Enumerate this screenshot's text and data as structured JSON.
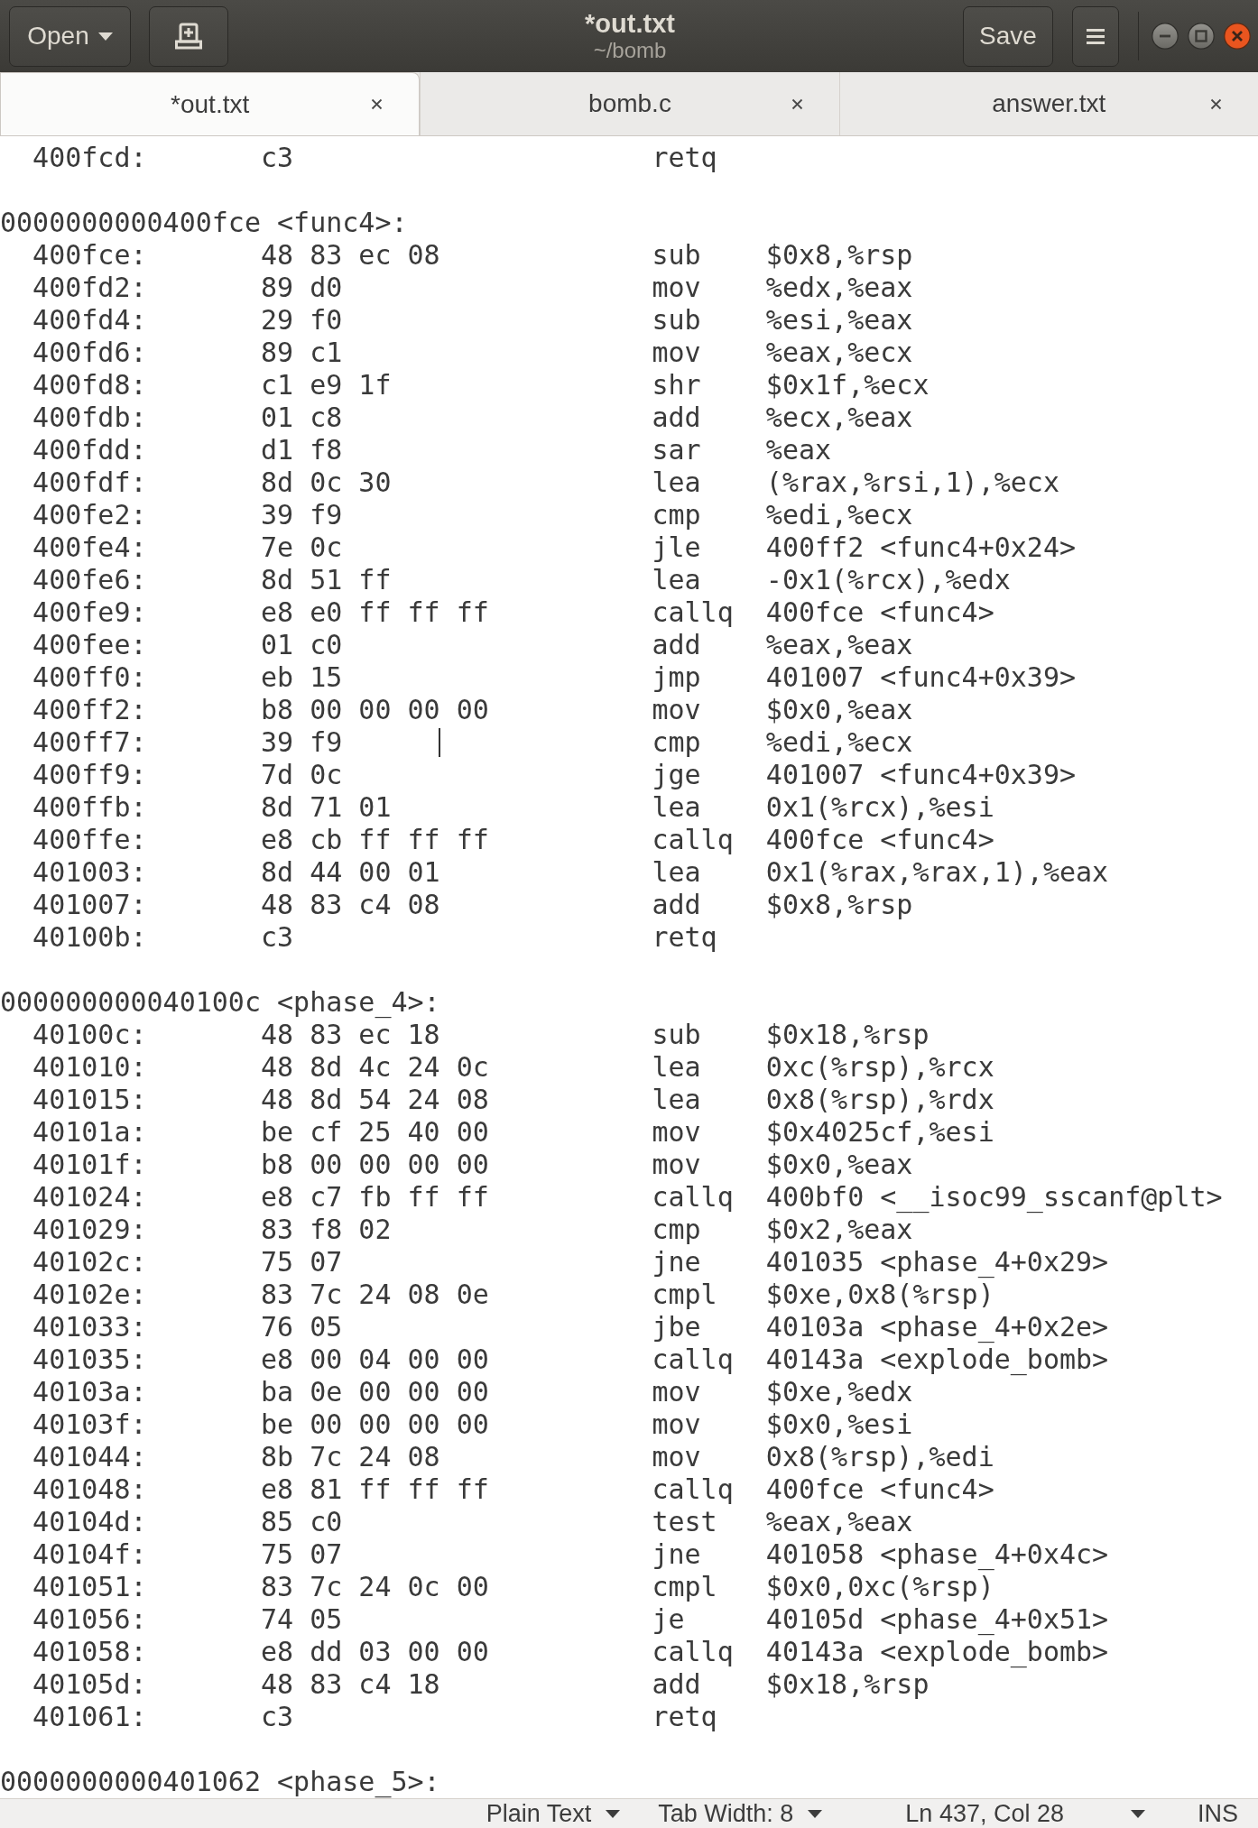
{
  "window": {
    "title": "*out.txt",
    "subtitle": "~/bomb"
  },
  "header": {
    "open_button": "Open",
    "save_button": "Save"
  },
  "tabs": [
    {
      "label": "*out.txt",
      "selected": true
    },
    {
      "label": "bomb.c",
      "selected": false
    },
    {
      "label": "answer.txt",
      "selected": false
    }
  ],
  "editor": {
    "lines": [
      {
        "kind": "instruction",
        "address": "400fcd:",
        "bytes": "c3",
        "mnemonic": "retq",
        "caret": false
      },
      {
        "kind": "blank",
        "caret": false
      },
      {
        "kind": "label",
        "text": "0000000000400fce <func4>:",
        "caret": false
      },
      {
        "kind": "instruction",
        "address": "400fce:",
        "bytes": "48 83 ec 08",
        "mnemonic": "sub",
        "operands": "$0x8,%rsp",
        "caret": false
      },
      {
        "kind": "instruction",
        "address": "400fd2:",
        "bytes": "89 d0",
        "mnemonic": "mov",
        "operands": "%edx,%eax",
        "caret": false
      },
      {
        "kind": "instruction",
        "address": "400fd4:",
        "bytes": "29 f0",
        "mnemonic": "sub",
        "operands": "%esi,%eax",
        "caret": false
      },
      {
        "kind": "instruction",
        "address": "400fd6:",
        "bytes": "89 c1",
        "mnemonic": "mov",
        "operands": "%eax,%ecx",
        "caret": false
      },
      {
        "kind": "instruction",
        "address": "400fd8:",
        "bytes": "c1 e9 1f",
        "mnemonic": "shr",
        "operands": "$0x1f,%ecx",
        "caret": false
      },
      {
        "kind": "instruction",
        "address": "400fdb:",
        "bytes": "01 c8",
        "mnemonic": "add",
        "operands": "%ecx,%eax",
        "caret": false
      },
      {
        "kind": "instruction",
        "address": "400fdd:",
        "bytes": "d1 f8",
        "mnemonic": "sar",
        "operands": "%eax",
        "caret": false
      },
      {
        "kind": "instruction",
        "address": "400fdf:",
        "bytes": "8d 0c 30",
        "mnemonic": "lea",
        "operands": "(%rax,%rsi,1),%ecx",
        "caret": false
      },
      {
        "kind": "instruction",
        "address": "400fe2:",
        "bytes": "39 f9",
        "mnemonic": "cmp",
        "operands": "%edi,%ecx",
        "caret": false
      },
      {
        "kind": "instruction",
        "address": "400fe4:",
        "bytes": "7e 0c",
        "mnemonic": "jle",
        "operands": "400ff2 <func4+0x24>",
        "caret": false
      },
      {
        "kind": "instruction",
        "address": "400fe6:",
        "bytes": "8d 51 ff",
        "mnemonic": "lea",
        "operands": "-0x1(%rcx),%edx",
        "caret": false
      },
      {
        "kind": "instruction",
        "address": "400fe9:",
        "bytes": "e8 e0 ff ff ff",
        "mnemonic": "callq",
        "operands": "400fce <func4>",
        "caret": false
      },
      {
        "kind": "instruction",
        "address": "400fee:",
        "bytes": "01 c0",
        "mnemonic": "add",
        "operands": "%eax,%eax",
        "caret": false
      },
      {
        "kind": "instruction",
        "address": "400ff0:",
        "bytes": "eb 15",
        "mnemonic": "jmp",
        "operands": "401007 <func4+0x39>",
        "caret": false
      },
      {
        "kind": "instruction",
        "address": "400ff2:",
        "bytes": "b8 00 00 00 00",
        "mnemonic": "mov",
        "operands": "$0x0,%eax",
        "caret": false
      },
      {
        "kind": "instruction",
        "address": "400ff7:",
        "bytes": "39 f9",
        "mnemonic": "cmp",
        "operands": "%edi,%ecx",
        "caret": true
      },
      {
        "kind": "instruction",
        "address": "400ff9:",
        "bytes": "7d 0c",
        "mnemonic": "jge",
        "operands": "401007 <func4+0x39>",
        "caret": false
      },
      {
        "kind": "instruction",
        "address": "400ffb:",
        "bytes": "8d 71 01",
        "mnemonic": "lea",
        "operands": "0x1(%rcx),%esi",
        "caret": false
      },
      {
        "kind": "instruction",
        "address": "400ffe:",
        "bytes": "e8 cb ff ff ff",
        "mnemonic": "callq",
        "operands": "400fce <func4>",
        "caret": false
      },
      {
        "kind": "instruction",
        "address": "401003:",
        "bytes": "8d 44 00 01",
        "mnemonic": "lea",
        "operands": "0x1(%rax,%rax,1),%eax",
        "caret": false
      },
      {
        "kind": "instruction",
        "address": "401007:",
        "bytes": "48 83 c4 08",
        "mnemonic": "add",
        "operands": "$0x8,%rsp",
        "caret": false
      },
      {
        "kind": "instruction",
        "address": "40100b:",
        "bytes": "c3",
        "mnemonic": "retq",
        "caret": false
      },
      {
        "kind": "blank",
        "caret": false
      },
      {
        "kind": "label",
        "text": "000000000040100c <phase_4>:",
        "caret": false
      },
      {
        "kind": "instruction",
        "address": "40100c:",
        "bytes": "48 83 ec 18",
        "mnemonic": "sub",
        "operands": "$0x18,%rsp",
        "caret": false
      },
      {
        "kind": "instruction",
        "address": "401010:",
        "bytes": "48 8d 4c 24 0c",
        "mnemonic": "lea",
        "operands": "0xc(%rsp),%rcx",
        "caret": false
      },
      {
        "kind": "instruction",
        "address": "401015:",
        "bytes": "48 8d 54 24 08",
        "mnemonic": "lea",
        "operands": "0x8(%rsp),%rdx",
        "caret": false
      },
      {
        "kind": "instruction",
        "address": "40101a:",
        "bytes": "be cf 25 40 00",
        "mnemonic": "mov",
        "operands": "$0x4025cf,%esi",
        "caret": false
      },
      {
        "kind": "instruction",
        "address": "40101f:",
        "bytes": "b8 00 00 00 00",
        "mnemonic": "mov",
        "operands": "$0x0,%eax",
        "caret": false
      },
      {
        "kind": "instruction",
        "address": "401024:",
        "bytes": "e8 c7 fb ff ff",
        "mnemonic": "callq",
        "operands": "400bf0 <__isoc99_sscanf@plt>",
        "caret": false
      },
      {
        "kind": "instruction",
        "address": "401029:",
        "bytes": "83 f8 02",
        "mnemonic": "cmp",
        "operands": "$0x2,%eax",
        "caret": false
      },
      {
        "kind": "instruction",
        "address": "40102c:",
        "bytes": "75 07",
        "mnemonic": "jne",
        "operands": "401035 <phase_4+0x29>",
        "caret": false
      },
      {
        "kind": "instruction",
        "address": "40102e:",
        "bytes": "83 7c 24 08 0e",
        "mnemonic": "cmpl",
        "operands": "$0xe,0x8(%rsp)",
        "caret": false
      },
      {
        "kind": "instruction",
        "address": "401033:",
        "bytes": "76 05",
        "mnemonic": "jbe",
        "operands": "40103a <phase_4+0x2e>",
        "caret": false
      },
      {
        "kind": "instruction",
        "address": "401035:",
        "bytes": "e8 00 04 00 00",
        "mnemonic": "callq",
        "operands": "40143a <explode_bomb>",
        "caret": false
      },
      {
        "kind": "instruction",
        "address": "40103a:",
        "bytes": "ba 0e 00 00 00",
        "mnemonic": "mov",
        "operands": "$0xe,%edx",
        "caret": false
      },
      {
        "kind": "instruction",
        "address": "40103f:",
        "bytes": "be 00 00 00 00",
        "mnemonic": "mov",
        "operands": "$0x0,%esi",
        "caret": false
      },
      {
        "kind": "instruction",
        "address": "401044:",
        "bytes": "8b 7c 24 08",
        "mnemonic": "mov",
        "operands": "0x8(%rsp),%edi",
        "caret": false
      },
      {
        "kind": "instruction",
        "address": "401048:",
        "bytes": "e8 81 ff ff ff",
        "mnemonic": "callq",
        "operands": "400fce <func4>",
        "caret": false
      },
      {
        "kind": "instruction",
        "address": "40104d:",
        "bytes": "85 c0",
        "mnemonic": "test",
        "operands": "%eax,%eax",
        "caret": false
      },
      {
        "kind": "instruction",
        "address": "40104f:",
        "bytes": "75 07",
        "mnemonic": "jne",
        "operands": "401058 <phase_4+0x4c>",
        "caret": false
      },
      {
        "kind": "instruction",
        "address": "401051:",
        "bytes": "83 7c 24 0c 00",
        "mnemonic": "cmpl",
        "operands": "$0x0,0xc(%rsp)",
        "caret": false
      },
      {
        "kind": "instruction",
        "address": "401056:",
        "bytes": "74 05",
        "mnemonic": "je",
        "operands": "40105d <phase_4+0x51>",
        "caret": false
      },
      {
        "kind": "instruction",
        "address": "401058:",
        "bytes": "e8 dd 03 00 00",
        "mnemonic": "callq",
        "operands": "40143a <explode_bomb>",
        "caret": false
      },
      {
        "kind": "instruction",
        "address": "40105d:",
        "bytes": "48 83 c4 18",
        "mnemonic": "add",
        "operands": "$0x18,%rsp",
        "caret": false
      },
      {
        "kind": "instruction",
        "address": "401061:",
        "bytes": "c3",
        "mnemonic": "retq",
        "caret": false
      },
      {
        "kind": "blank",
        "caret": false
      },
      {
        "kind": "label",
        "text": "0000000000401062 <phase_5>:",
        "caret": false
      }
    ]
  },
  "status_bar": {
    "language": "Plain Text",
    "tab_width": "Tab Width: 8",
    "position": "Ln 437, Col 28",
    "mode": "INS"
  }
}
